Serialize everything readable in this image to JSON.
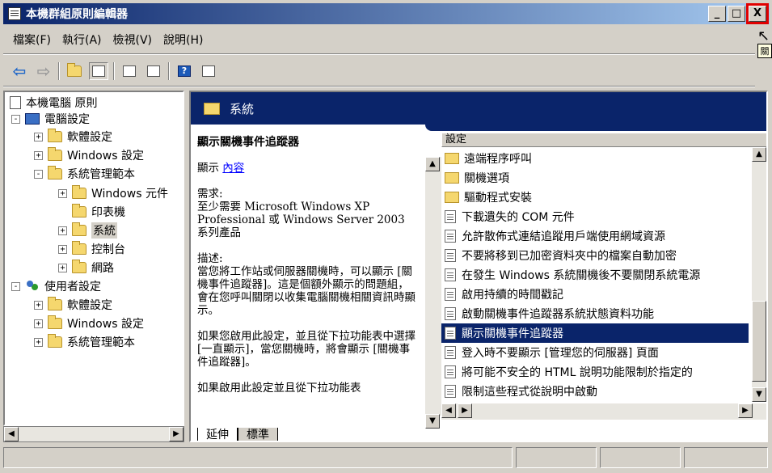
{
  "window": {
    "title": "本機群組原則編輯器",
    "buttons": {
      "minimize": "_",
      "maximize": "□",
      "close": "X"
    }
  },
  "tooltip": {
    "text": "關"
  },
  "menu": [
    {
      "label": "檔案(F)"
    },
    {
      "label": "執行(A)"
    },
    {
      "label": "檢視(V)"
    },
    {
      "label": "說明(H)"
    }
  ],
  "toolbar": {
    "help_glyph": "?"
  },
  "tree": {
    "root": "本機電腦 原則",
    "computer_config": "電腦設定",
    "software": "軟體設定",
    "windows_settings": "Windows 設定",
    "admin_templates": "系統管理範本",
    "win_components": "Windows 元件",
    "printers": "印表機",
    "system": "系統",
    "control_panel": "控制台",
    "network": "網路",
    "user_config": "使用者設定",
    "u_software": "軟體設定",
    "u_windows_settings": "Windows 設定",
    "u_admin_templates": "系統管理範本",
    "expand_plus": "+",
    "collapse_minus": "-"
  },
  "panel": {
    "header": "系統",
    "desc_title": "顯示關機事件追蹤器",
    "display_label": "顯示",
    "display_link": "內容",
    "requirements_label": "需求:",
    "requirements_text": "至少需要 Microsoft Windows XP Professional 或 Windows Server 2003 系列產品",
    "description_label": "描述:",
    "description_text": "當您將工作站或伺服器關機時，可以顯示 [關機事件追蹤器]。這是個額外顯示的問題組，會在您呼叫關閉以收集電腦關機相關資訊時顯示。",
    "para2": "如果您啟用此設定，並且從下拉功能表中選擇 [一直顯示]，當您關機時，將會顯示 [關機事件追蹤器]。",
    "para3": "如果啟用此設定並且從下拉功能表"
  },
  "list": {
    "header": "設定",
    "items": [
      {
        "label": "遠端程序呼叫",
        "type": "folder"
      },
      {
        "label": "關機選項",
        "type": "folder"
      },
      {
        "label": "驅動程式安裝",
        "type": "folder"
      },
      {
        "label": "下載遺失的 COM 元件",
        "type": "setting"
      },
      {
        "label": "允許散佈式連結追蹤用戶端使用網域資源",
        "type": "setting"
      },
      {
        "label": "不要將移到已加密資料夾中的檔案自動加密",
        "type": "setting"
      },
      {
        "label": "在發生 Windows 系統關機後不要關閉系統電源",
        "type": "setting"
      },
      {
        "label": "啟用持續的時間戳記",
        "type": "setting"
      },
      {
        "label": "啟動關機事件追蹤器系統狀態資料功能",
        "type": "setting"
      },
      {
        "label": "顯示關機事件追蹤器",
        "type": "setting",
        "selected": true
      },
      {
        "label": "登入時不要顯示 [管理您的伺服器] 頁面",
        "type": "setting"
      },
      {
        "label": "將可能不安全的 HTML 說明功能限制於指定的",
        "type": "setting"
      },
      {
        "label": "限制這些程式從說明中啟動",
        "type": "setting"
      }
    ]
  },
  "tabs": [
    {
      "label": "延伸"
    },
    {
      "label": "標準"
    }
  ]
}
